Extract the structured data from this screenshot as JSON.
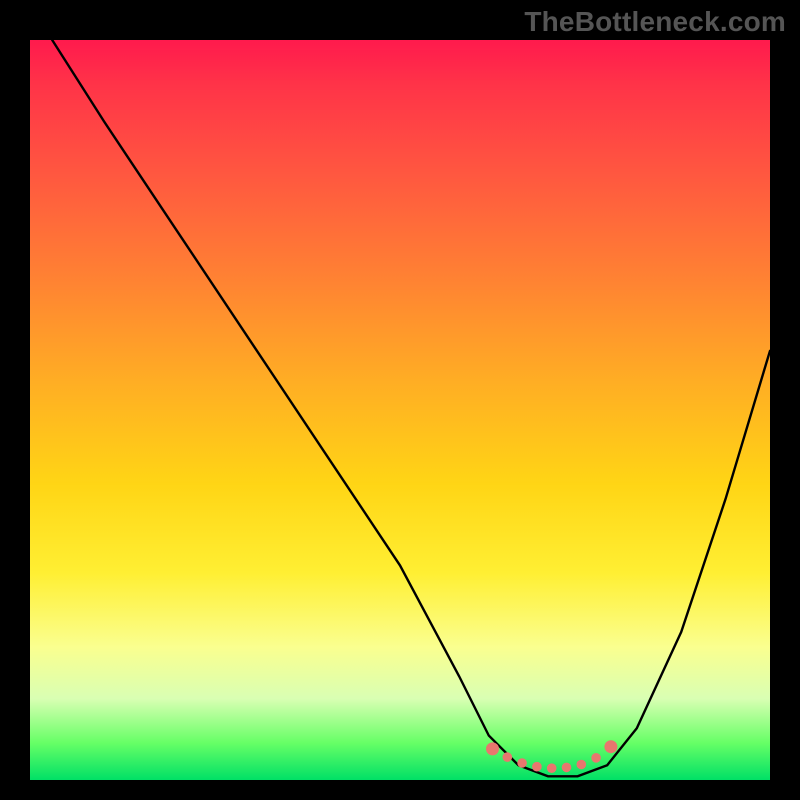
{
  "watermark": "TheBottleneck.com",
  "chart_data": {
    "type": "line",
    "title": "",
    "xlabel": "",
    "ylabel": "",
    "xlim": [
      0,
      100
    ],
    "ylim": [
      0,
      100
    ],
    "grid": false,
    "legend": false,
    "background_gradient": {
      "direction": "vertical",
      "stops": [
        {
          "pos": 0,
          "color": "#ff1a4d"
        },
        {
          "pos": 18,
          "color": "#ff5740"
        },
        {
          "pos": 46,
          "color": "#ffad24"
        },
        {
          "pos": 72,
          "color": "#ffef33"
        },
        {
          "pos": 89,
          "color": "#d9ffb3"
        },
        {
          "pos": 100,
          "color": "#00e066"
        }
      ]
    },
    "series": [
      {
        "name": "bottleneck-curve",
        "x": [
          3,
          10,
          20,
          30,
          40,
          50,
          58,
          62,
          66,
          70,
          74,
          78,
          82,
          88,
          94,
          100
        ],
        "y": [
          100,
          89,
          74,
          59,
          44,
          29,
          14,
          6,
          2,
          0.5,
          0.5,
          2,
          7,
          20,
          38,
          58
        ]
      }
    ],
    "markers": {
      "name": "flat-region-dots",
      "color": "#e8776e",
      "x": [
        62.5,
        64.5,
        66.5,
        68.5,
        70.5,
        72.5,
        74.5,
        76.5,
        78.5
      ],
      "y": [
        4.2,
        3.1,
        2.3,
        1.8,
        1.6,
        1.7,
        2.1,
        3.0,
        4.5
      ]
    }
  }
}
